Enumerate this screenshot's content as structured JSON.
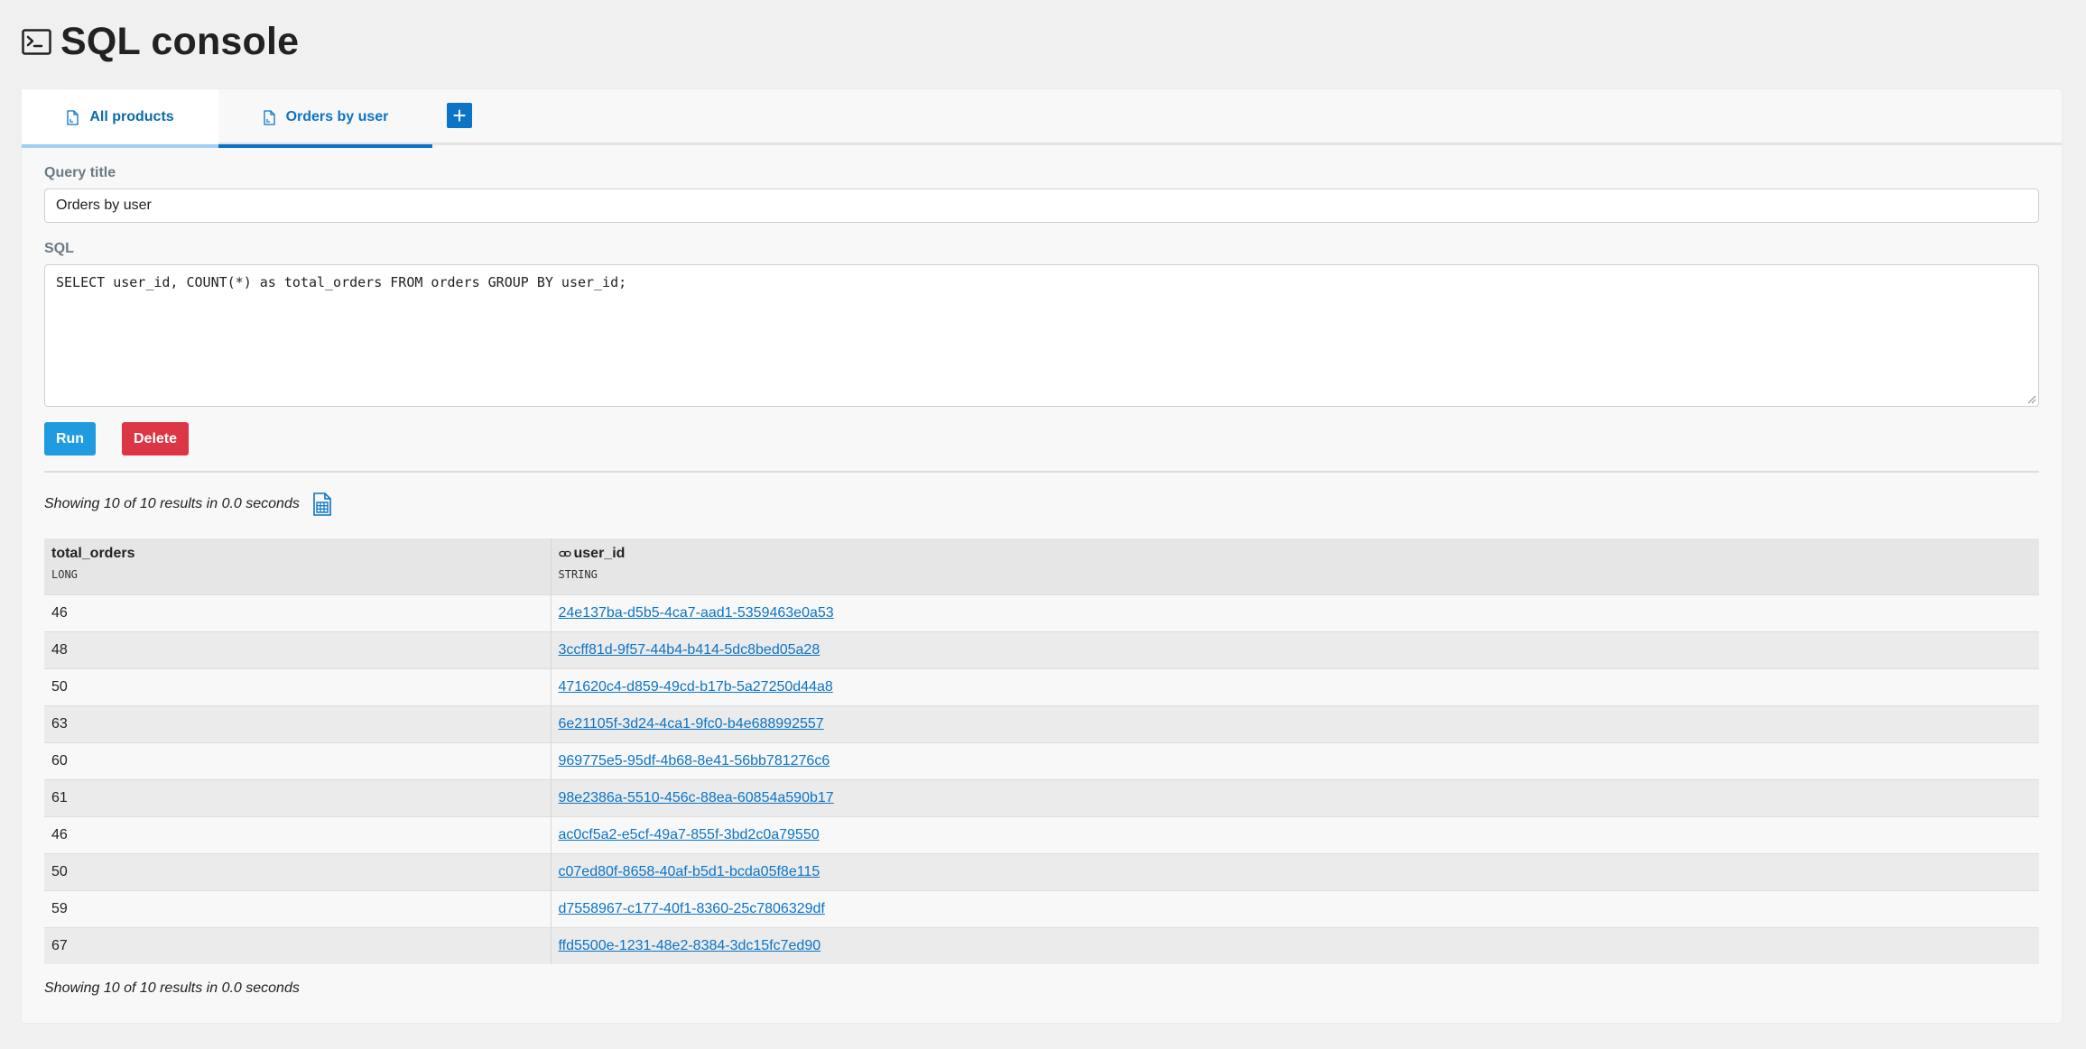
{
  "page": {
    "title": "SQL console",
    "icon": "terminal-icon"
  },
  "tabs": [
    {
      "label": "All products",
      "icon": "document-icon"
    },
    {
      "label": "Orders by user",
      "icon": "document-icon"
    }
  ],
  "add_tab": {
    "label": "+",
    "icon": "plus-icon"
  },
  "form": {
    "title_label": "Query title",
    "title_value": "Orders by user",
    "sql_label": "SQL",
    "sql_value": "SELECT user_id, COUNT(*) as total_orders FROM orders GROUP BY user_id;"
  },
  "actions": {
    "run_label": "Run",
    "delete_label": "Delete"
  },
  "results": {
    "summary": "Showing 10 of 10 results in 0.0 seconds",
    "export_icon": "spreadsheet-icon",
    "columns": [
      {
        "name": "total_orders",
        "type": "LONG"
      },
      {
        "name": "user_id",
        "type": "STRING",
        "icon": "link-icon"
      }
    ],
    "rows": [
      {
        "total_orders": "46",
        "user_id": "24e137ba-d5b5-4ca7-aad1-5359463e0a53"
      },
      {
        "total_orders": "48",
        "user_id": "3ccff81d-9f57-44b4-b414-5dc8bed05a28"
      },
      {
        "total_orders": "50",
        "user_id": "471620c4-d859-49cd-b17b-5a27250d44a8"
      },
      {
        "total_orders": "63",
        "user_id": "6e21105f-3d24-4ca1-9fc0-b4e688992557"
      },
      {
        "total_orders": "60",
        "user_id": "969775e5-95df-4b68-8e41-56bb781276c6"
      },
      {
        "total_orders": "61",
        "user_id": "98e2386a-5510-456c-88ea-60854a590b17"
      },
      {
        "total_orders": "46",
        "user_id": "ac0cf5a2-e5cf-49a7-855f-3bd2c0a79550"
      },
      {
        "total_orders": "50",
        "user_id": "c07ed80f-8658-40af-b5d1-bcda05f8e115"
      },
      {
        "total_orders": "59",
        "user_id": "d7558967-c177-40f1-8360-25c7806329df"
      },
      {
        "total_orders": "67",
        "user_id": "ffd5500e-1231-48e2-8384-3dc15fc7ed90"
      }
    ],
    "footer_summary": "Showing 10 of 10 results in 0.0 seconds"
  },
  "colors": {
    "accent": "#0b74c6",
    "run": "#1f9be0",
    "delete": "#dc3545"
  }
}
